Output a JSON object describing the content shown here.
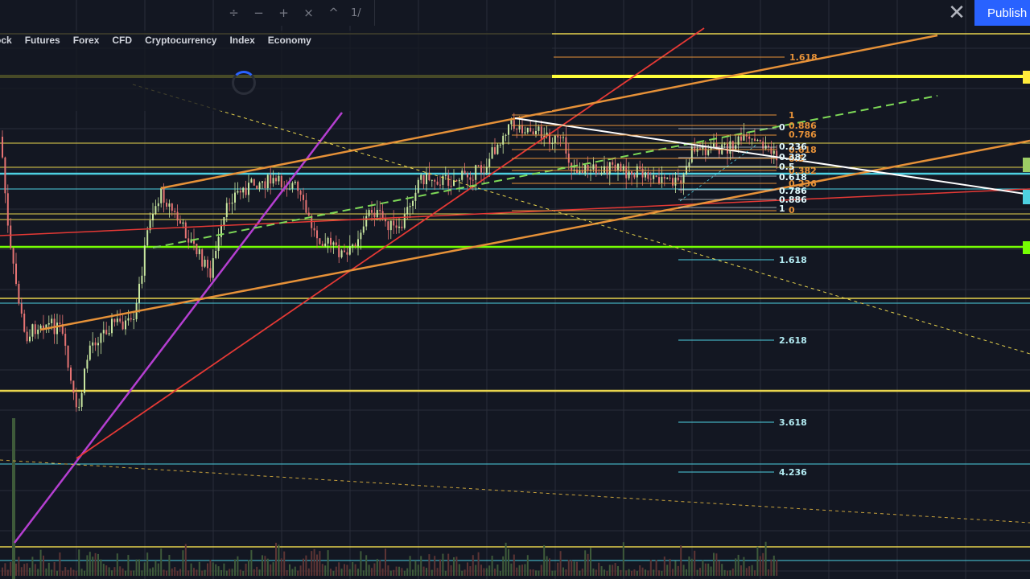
{
  "toolbar": {
    "buttons": [
      {
        "name": "divide-tool-icon",
        "glyph": "÷"
      },
      {
        "name": "minus-tool-icon",
        "glyph": "−"
      },
      {
        "name": "plus-tool-icon",
        "glyph": "+"
      },
      {
        "name": "cross-tool-icon",
        "glyph": "×"
      },
      {
        "name": "caret-tool-icon",
        "glyph": "^"
      }
    ],
    "page_label": "1/"
  },
  "header": {
    "close_glyph": "✕",
    "publish_label": "Publish"
  },
  "nav": {
    "tabs": [
      "ock",
      "Futures",
      "Forex",
      "CFD",
      "Cryptocurrency",
      "Index",
      "Economy"
    ]
  },
  "fib_retracement_labels": [
    "1",
    "0.886",
    "0.786",
    "0.618",
    "0.5",
    "0.382",
    "0.236",
    "0"
  ],
  "fib_levels_secondary": [
    "0",
    "0.236",
    "0.382",
    "0.5",
    "0.618",
    "0.786",
    "0.886",
    "1"
  ],
  "fib_extension_labels": [
    "1.618",
    "2.618",
    "3.618",
    "4.236"
  ],
  "fib_top_label": "1.618",
  "colors": {
    "background": "#131722",
    "grid": "#2a2e39",
    "candle_up": "#c8e6a0",
    "candle_down": "#e57373",
    "yellow": "#e8d44d",
    "cyan": "#4dd0e1",
    "lime": "#7fff00",
    "orange": "#e69138",
    "red": "#e53935",
    "magenta": "#b53fd1",
    "white": "#ffffff",
    "publish": "#2962ff"
  }
}
